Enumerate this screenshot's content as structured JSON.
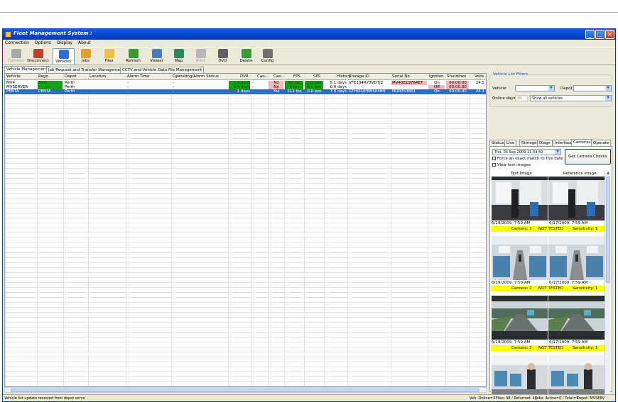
{
  "app": {
    "title": "Fleet Management System :",
    "window_buttons": {
      "minimize": "_",
      "maximize": "□",
      "close": "×"
    }
  },
  "menu": [
    "Connection",
    "Options",
    "Display",
    "About"
  ],
  "toolbar": [
    {
      "label": "Connect",
      "icon": "connect-icon",
      "state": "disabled",
      "color": "#a8a8a8"
    },
    {
      "label": "Disconnect",
      "icon": "disconnect-icon",
      "state": "normal",
      "color": "#c04030"
    },
    {
      "label": "Vehicles",
      "icon": "vehicles-icon",
      "state": "selected",
      "color": "#2f6fd0"
    },
    {
      "label": "Jobs",
      "icon": "jobs-icon",
      "state": "normal",
      "color": "#e0a030"
    },
    {
      "label": "Files",
      "icon": "files-icon",
      "state": "normal",
      "color": "#f0c040"
    },
    {
      "label": "Refresh",
      "icon": "refresh-icon",
      "state": "normal",
      "color": "#3a9a3a"
    },
    {
      "label": "Viewer",
      "icon": "viewer-icon",
      "state": "normal",
      "color": "#4a7ac0"
    },
    {
      "label": "Map",
      "icon": "map-icon",
      "state": "normal",
      "color": "#2a8a5a"
    },
    {
      "label": "Print",
      "icon": "print-icon",
      "state": "disabled",
      "color": "#b8b8b8"
    },
    {
      "label": "DVD",
      "icon": "dvd-icon",
      "state": "normal",
      "color": "#606060"
    },
    {
      "label": "Delete",
      "icon": "delete-icon",
      "state": "normal",
      "color": "#3a9a3a"
    },
    {
      "label": "Config",
      "icon": "config-icon",
      "state": "normal",
      "color": "#707070"
    }
  ],
  "main_tabs": [
    {
      "label": "Vehicle Management",
      "active": true
    },
    {
      "label": "Job Request and Transfer Management",
      "active": false
    },
    {
      "label": "CCTV and Vehicle Data File Management",
      "active": false
    }
  ],
  "grid": {
    "columns": [
      "Vehicle",
      "Rego",
      "Depot",
      "Location",
      "Alarm Time",
      "Operating/Alarm Status",
      "DVR",
      "Can...",
      "Can...",
      "FPS",
      "SPS",
      "History",
      "Storage ID",
      "Serial No",
      "Ignition",
      "Shutdown",
      "Volts"
    ],
    "rows": [
      {
        "cells": [
          "MV4",
          "MV4",
          "Perth",
          "",
          "-",
          "-",
          "1.4 days",
          "-",
          "No",
          "86 fps",
          "0.0 pps",
          "5.1 days",
          "VFE104R73VDTJZ",
          "MV4081976AEF",
          "On",
          "00:00:00",
          "24.5"
        ],
        "selected": false
      },
      {
        "cells": [
          "MVSERVER-",
          "",
          "Perth",
          "",
          "-",
          "-",
          "1.4 days",
          "-",
          "No",
          "0 fps",
          "0.0 pps",
          "0.0 days",
          "",
          "",
          "Off",
          "00:00:00",
          ""
        ],
        "selected": false
      },
      {
        "cells": [
          "PENTA",
          "PENTA",
          "Perth",
          "",
          "-",
          "-",
          "1 days",
          "-",
          "Yes",
          "212 fps",
          "0.0 pps",
          "7.6 days",
          "GTH002PBHS048H",
          "NOR053801",
          "On",
          "00:00:00",
          "24.1"
        ],
        "selected": true
      }
    ],
    "colors": {
      "green": "#14a014",
      "pink": "#f4b8b8",
      "select": "#316ac5"
    }
  },
  "filters": {
    "title": "Vehicle List Filters",
    "vehicle_label": "Vehicle",
    "vehicle_value": "",
    "depot_label": "Depot",
    "depot_value": "",
    "online_label": "Online days",
    "online_value": "30",
    "show_value": "Show all vehicles"
  },
  "right_tabs": [
    {
      "label": "Status",
      "active": false
    },
    {
      "label": "Live",
      "active": false
    },
    {
      "label": "Storage",
      "active": false
    },
    {
      "label": "Diags",
      "active": false
    },
    {
      "label": "Interface",
      "active": false
    },
    {
      "label": "Cameras",
      "active": true
    },
    {
      "label": "Operate",
      "active": false
    }
  ],
  "cameras": {
    "date_value": "Thu, 03 Sep 2009   11:34:50",
    "force_exact_label": "Force an exact match to this date",
    "view_test_label": "View test images",
    "get_checks_label": "Get Camera Checks",
    "test_image_label": "Test Image",
    "reference_image_label": "Reference image",
    "items": [
      {
        "test_time": "6/19/2009, 7:59 AM",
        "ref_time": "6/17/2009, 7:59 AM",
        "camera": "Camera: 1",
        "status": "NOT TESTED",
        "sensitivity": "Sensitivity: 1",
        "scene": "bus-front"
      },
      {
        "test_time": "6/19/2009, 7:59 AM",
        "ref_time": "6/17/2009, 7:59 AM",
        "camera": "Camera: 2",
        "status": "NOT TESTED",
        "sensitivity": "Sensitivity: 1",
        "scene": "bus-aisle"
      },
      {
        "test_time": "6/19/2009, 7:59 AM",
        "ref_time": "6/17/2009, 7:59 AM",
        "camera": "Camera: 3",
        "status": "NOT TESTED",
        "sensitivity": "Sensitivity: 1",
        "scene": "road"
      },
      {
        "test_time": "6/19/2009, 7:59 AM",
        "ref_time": "6/17/2009, 7:59 AM",
        "camera": "Camera: 4",
        "status": "NOT TESTED",
        "sensitivity": "Sensitivity: 1",
        "scene": "bus-seats"
      }
    ]
  },
  "status_bar": {
    "left": "Vehicle list update received from depot serve",
    "veh": "Veh: Online=3",
    "files": "Files: 98 / Returned: 46",
    "jobs": "Jobs: Active=0 / Total=3",
    "depot": "Depot: MVSERV"
  }
}
